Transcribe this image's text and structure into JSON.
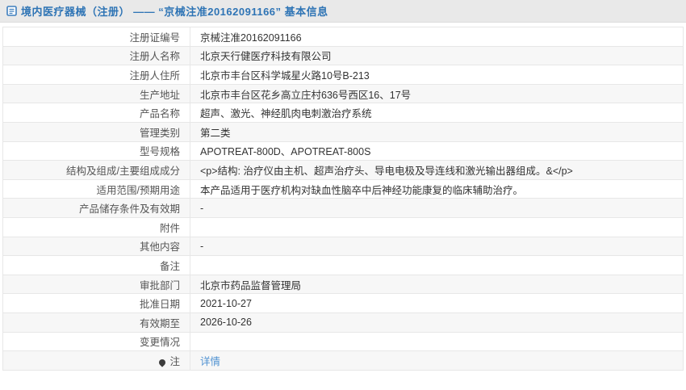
{
  "colors": {
    "accent": "#2e74b5",
    "link": "#4f92d2",
    "header_bg": "#e9e9e9",
    "stripe": "#f7f7f7",
    "border": "#e7e7e7",
    "label_text": "#555555",
    "value_text": "#333333"
  },
  "header": {
    "icon": "document-icon",
    "title": "境内医疗器械（注册） —— “京械注准20162091166” 基本信息"
  },
  "table": {
    "rows": [
      {
        "label": "注册证编号",
        "value": "京械注准20162091166"
      },
      {
        "label": "注册人名称",
        "value": "北京天行健医疗科技有限公司"
      },
      {
        "label": "注册人住所",
        "value": "北京市丰台区科学城星火路10号B-213"
      },
      {
        "label": "生产地址",
        "value": "北京市丰台区花乡高立庄村636号西区16、17号"
      },
      {
        "label": "产品名称",
        "value": "超声、激光、神经肌肉电刺激治疗系统"
      },
      {
        "label": "管理类别",
        "value": "第二类"
      },
      {
        "label": "型号规格",
        "value": "APOTREAT-800D、APOTREAT-800S"
      },
      {
        "label": "结构及组成/主要组成成分",
        "value": "<p>结构: 治疗仪由主机、超声治疗头、导电电极及导连线和激光输出器组成。&</p>"
      },
      {
        "label": "适用范围/预期用途",
        "value": "本产品适用于医疗机构对缺血性脑卒中后神经功能康复的临床辅助治疗。"
      },
      {
        "label": "产品储存条件及有效期",
        "value": "-"
      },
      {
        "label": "附件",
        "value": ""
      },
      {
        "label": "其他内容",
        "value": "-"
      },
      {
        "label": "备注",
        "value": ""
      },
      {
        "label": "审批部门",
        "value": "北京市药品监督管理局"
      },
      {
        "label": "批准日期",
        "value": "2021-10-27"
      },
      {
        "label": "有效期至",
        "value": "2026-10-26"
      },
      {
        "label": "变更情况",
        "value": ""
      },
      {
        "label": "注",
        "value": "详情",
        "link": true,
        "icon": "pin-icon"
      }
    ]
  }
}
